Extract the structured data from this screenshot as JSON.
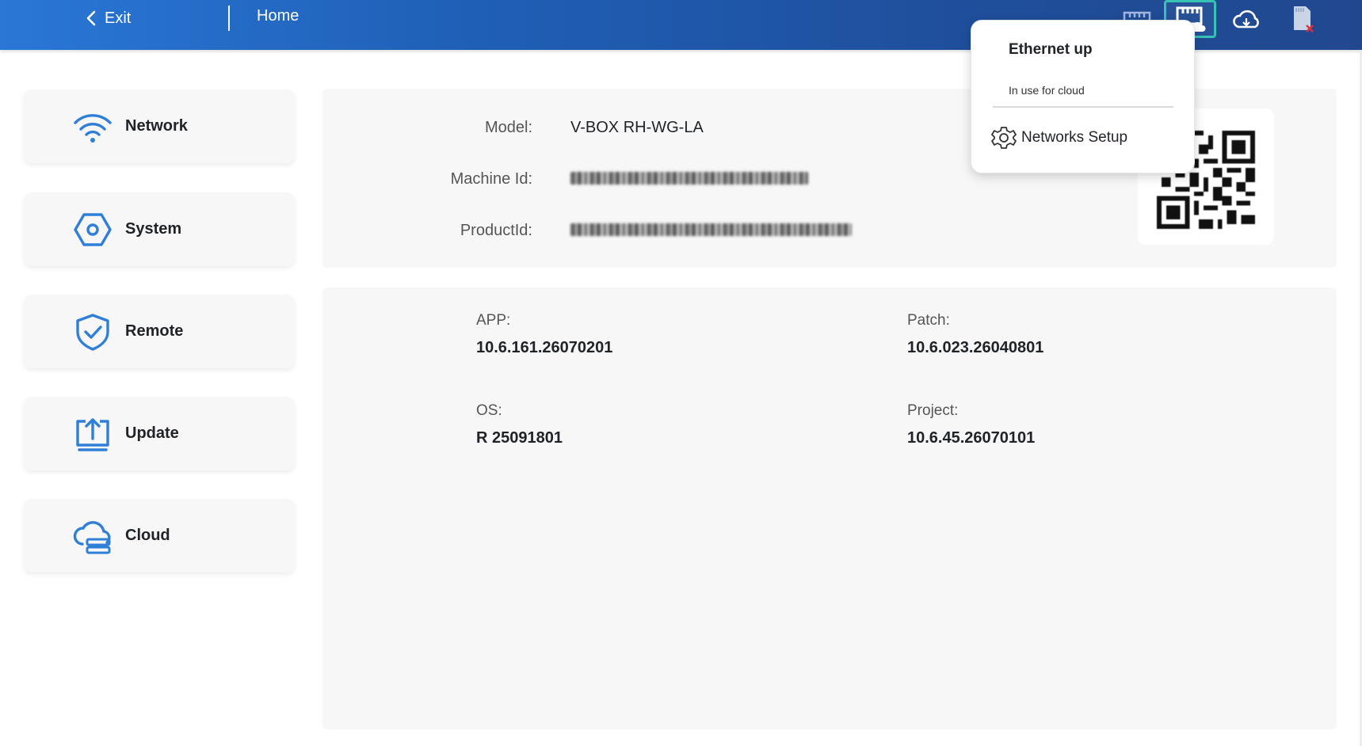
{
  "header": {
    "exit_label": "Exit",
    "breadcrumb": "Home",
    "status_icons": [
      "ethernet-icon",
      "ethernet-cloud-icon",
      "cloud-icon",
      "sd-card-missing-icon"
    ]
  },
  "sidebar": {
    "items": [
      {
        "label": "Network",
        "icon": "wifi-icon"
      },
      {
        "label": "System",
        "icon": "hexagon-settings-icon"
      },
      {
        "label": "Remote",
        "icon": "shield-check-icon"
      },
      {
        "label": "Update",
        "icon": "upload-icon"
      },
      {
        "label": "Cloud",
        "icon": "cloud-server-icon"
      }
    ]
  },
  "device": {
    "model_label": "Model:",
    "model_value": "V-BOX RH-WG-LA",
    "machine_id_label": "Machine Id:",
    "product_id_label": "ProductId:"
  },
  "versions": {
    "app_label": "APP:",
    "app_value": "10.6.161.26070201",
    "patch_label": "Patch:",
    "patch_value": "10.6.023.26040801",
    "os_label": "OS:",
    "os_value": "R 25091801",
    "project_label": "Project:",
    "project_value": "10.6.45.26070101"
  },
  "popup": {
    "title": "Ethernet up",
    "subtitle": "In use for cloud",
    "link_label": "Networks Setup"
  },
  "colors": {
    "accent": "#2a77d6",
    "icon_blue": "#2f7fd8",
    "active_outline": "#36c2b4",
    "sd_error": "#e0303b"
  }
}
